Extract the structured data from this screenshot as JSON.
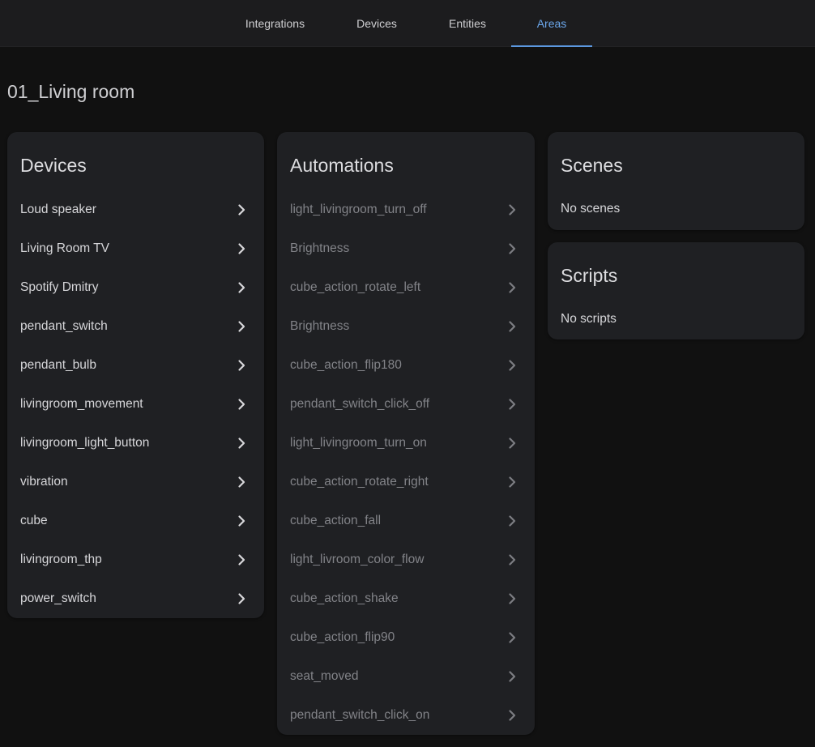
{
  "tabs": [
    {
      "label": "Integrations",
      "active": false
    },
    {
      "label": "Devices",
      "active": false
    },
    {
      "label": "Entities",
      "active": false
    },
    {
      "label": "Areas",
      "active": true
    }
  ],
  "page": {
    "title": "01_Living room"
  },
  "devices": {
    "title": "Devices",
    "items": [
      "Loud speaker",
      "Living Room TV",
      "Spotify Dmitry",
      "pendant_switch",
      "pendant_bulb",
      "livingroom_movement",
      "livingroom_light_button",
      "vibration",
      "cube",
      "livingroom_thp",
      "power_switch"
    ]
  },
  "automations": {
    "title": "Automations",
    "items": [
      "light_livingroom_turn_off",
      "Brightness",
      "cube_action_rotate_left",
      "Brightness",
      "cube_action_flip180",
      "pendant_switch_click_off",
      "light_livingroom_turn_on",
      "cube_action_rotate_right",
      "cube_action_fall",
      "light_livroom_color_flow",
      "cube_action_shake",
      "cube_action_flip90",
      "seat_moved",
      "pendant_switch_click_on"
    ]
  },
  "scenes": {
    "title": "Scenes",
    "empty_text": "No scenes"
  },
  "scripts": {
    "title": "Scripts",
    "empty_text": "No scripts"
  },
  "icons": {
    "row_chevron": "chevron-right-icon"
  },
  "colors": {
    "accent": "#5c98e0",
    "background": "#111111",
    "card": "#1f2023"
  }
}
